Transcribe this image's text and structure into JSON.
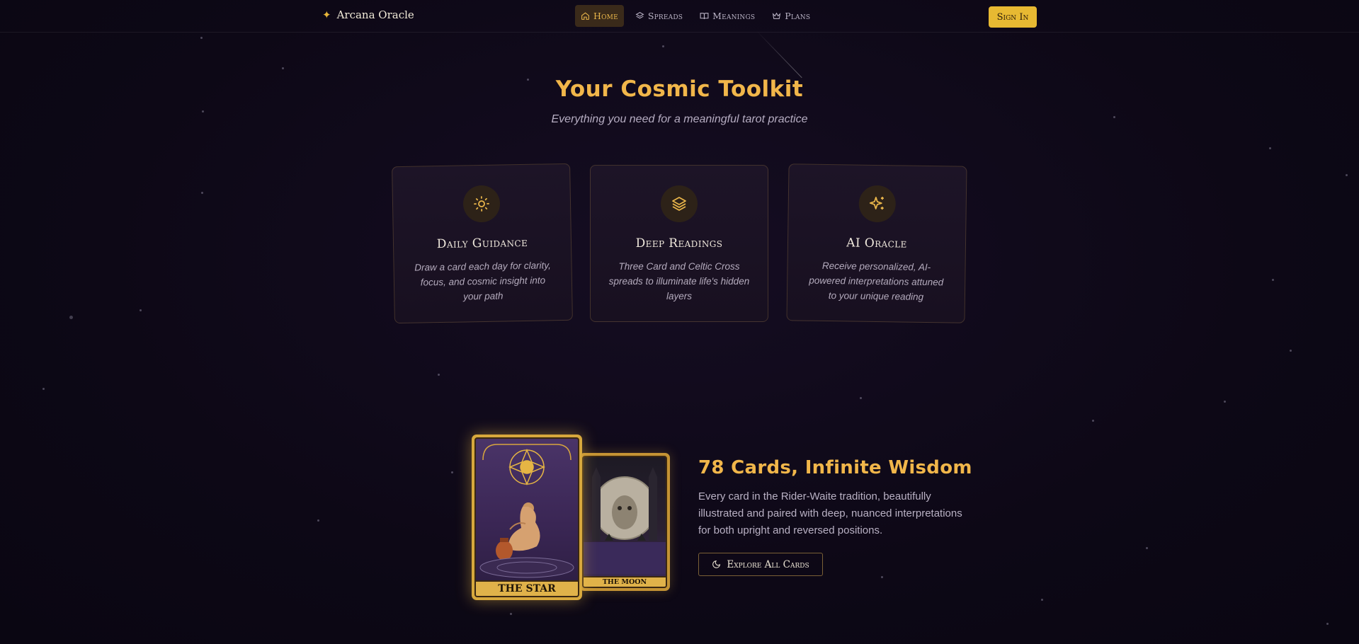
{
  "nav": {
    "brand": "Arcana Oracle",
    "links": [
      {
        "label": "Home",
        "icon": "home-icon",
        "active": true
      },
      {
        "label": "Spreads",
        "icon": "layers-icon",
        "active": false
      },
      {
        "label": "Meanings",
        "icon": "book-icon",
        "active": false
      },
      {
        "label": "Plans",
        "icon": "crown-icon",
        "active": false
      }
    ],
    "sign_in": "Sign In"
  },
  "hero": {
    "title": "Your Cosmic Toolkit",
    "subtitle": "Everything you need for a meaningful tarot practice"
  },
  "features": [
    {
      "title": "Daily Guidance",
      "icon": "sun-icon",
      "description": "Draw a card each day for clarity, focus, and cosmic insight into your path"
    },
    {
      "title": "Deep Readings",
      "icon": "layers-icon",
      "description": "Three Card and Celtic Cross spreads to illuminate life's hidden layers"
    },
    {
      "title": "AI Oracle",
      "icon": "sparkles-icon",
      "description": "Receive personalized, AI-powered interpretations attuned to your unique reading"
    }
  ],
  "cards_section": {
    "title": "78 Cards, Infinite Wisdom",
    "body": "Every card in the Rider-Waite tradition, beautifully illustrated and paired with deep, nuanced interpretations for both upright and reversed positions.",
    "button": "Explore All Cards",
    "button_icon": "moon-icon",
    "card_front": "THE STAR",
    "card_back": "THE MOON"
  },
  "colors": {
    "accent": "#f1b64a",
    "button_bg": "#e7b932",
    "background": "#0d0816"
  }
}
